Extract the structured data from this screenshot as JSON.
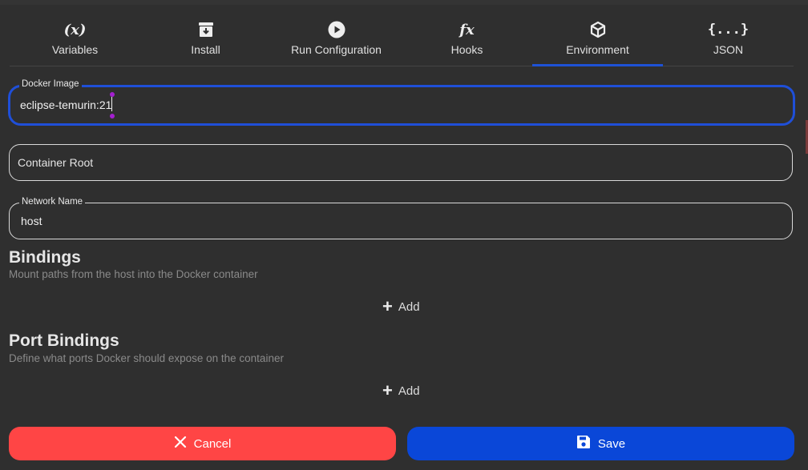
{
  "tabs": [
    {
      "label": "Variables",
      "icon": "variable-icon",
      "glyph": "(x)",
      "active": false
    },
    {
      "label": "Install",
      "icon": "archive-icon",
      "active": false
    },
    {
      "label": "Run Configuration",
      "icon": "play-circle-icon",
      "active": false
    },
    {
      "label": "Hooks",
      "icon": "function-icon",
      "glyph": "fx",
      "active": false
    },
    {
      "label": "Environment",
      "icon": "cube-icon",
      "active": true
    },
    {
      "label": "JSON",
      "icon": "braces-icon",
      "glyph": "{...}",
      "active": false
    }
  ],
  "fields": {
    "docker_image": {
      "label": "Docker Image",
      "value": "eclipse-temurin:21"
    },
    "container_root": {
      "placeholder": "Container Root",
      "value": ""
    },
    "network_name": {
      "label": "Network Name",
      "value": "host"
    }
  },
  "bindings": {
    "title": "Bindings",
    "subtitle": "Mount paths from the host into the Docker container",
    "add_label": "Add"
  },
  "port_bindings": {
    "title": "Port Bindings",
    "subtitle": "Define what ports Docker should expose on the container",
    "add_label": "Add"
  },
  "actions": {
    "cancel_label": "Cancel",
    "save_label": "Save"
  },
  "colors": {
    "background": "#2f2f2f",
    "accent": "#1e52d6",
    "cancel": "#ff4545",
    "save": "#0a47d8"
  }
}
